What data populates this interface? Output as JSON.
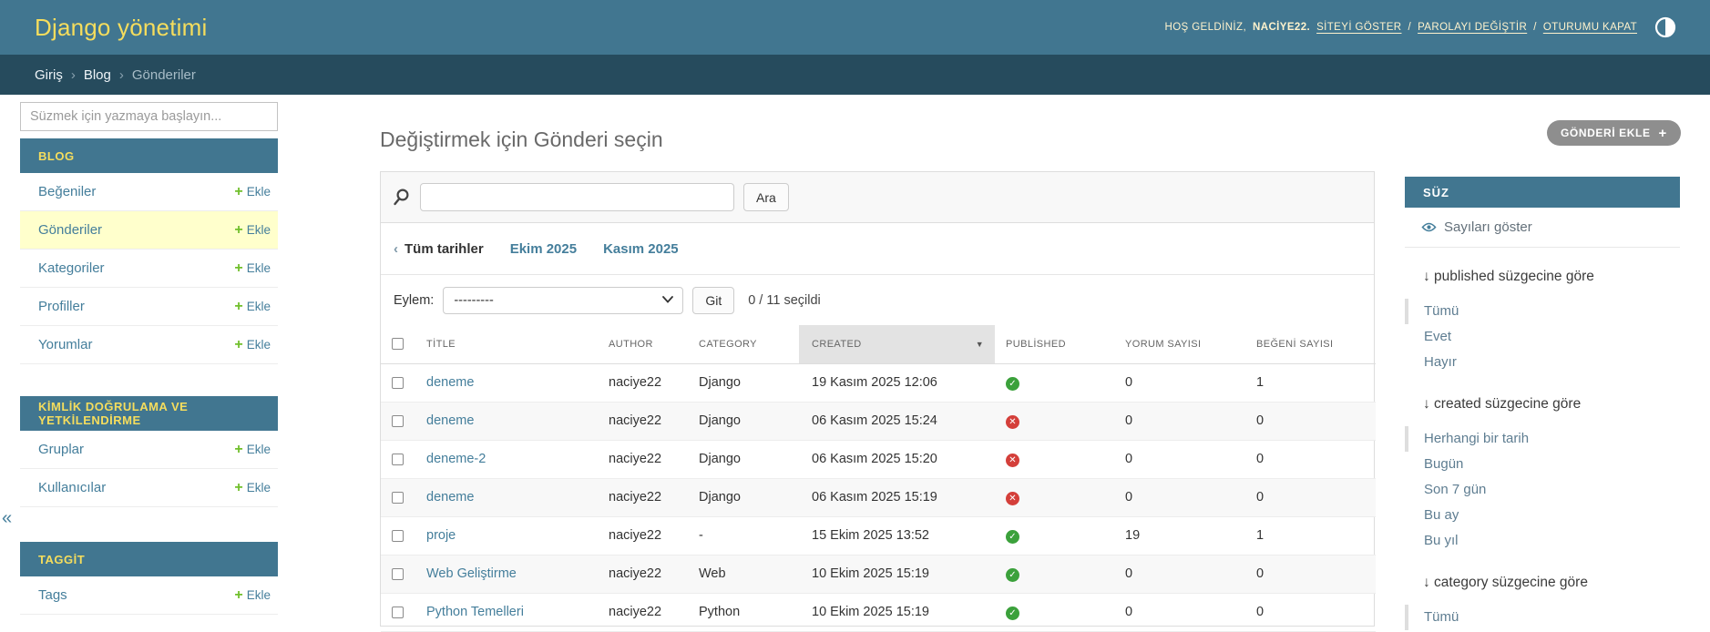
{
  "colors": {
    "header_bg": "#417690",
    "breadcrumbs_bg": "#264b5d",
    "accent": "#f5dd5d",
    "link": "#447e9b",
    "add_green": "#70bf2b",
    "selected_row_bg": "#ffffcc",
    "yes_green": "#3ba13b",
    "no_red": "#d43f3a",
    "sorted_col_bg": "#e3e3e3",
    "stripe_bg": "#f8f8f8",
    "button_gray": "#8e8e8e"
  },
  "header": {
    "title": "Django yönetimi",
    "welcome_prefix": "HOŞ GELDİNİZ,",
    "username": "NACİYE22.",
    "separator": "/",
    "links": [
      {
        "label": "SİTEYİ GÖSTER"
      },
      {
        "label": "PAROLAYI DEĞİŞTİR"
      },
      {
        "label": "OTURUMU KAPAT"
      }
    ]
  },
  "breadcrumbs": {
    "separator": "›",
    "items": [
      "Giriş",
      "Blog",
      "Gönderiler"
    ]
  },
  "sidebar": {
    "filter_placeholder": "Süzmek için yazmaya başlayın...",
    "collapse_icon": "«",
    "add_plus": "+",
    "add_label": "Ekle",
    "sections": [
      {
        "title": "BLOG",
        "items": [
          "Beğeniler",
          "Gönderiler",
          "Kategoriler",
          "Profiller",
          "Yorumlar"
        ],
        "selected": "Gönderiler"
      },
      {
        "title": "KİMLİK DOĞRULAMA VE YETKİLENDİRME",
        "items": [
          "Gruplar",
          "Kullanıcılar"
        ]
      },
      {
        "title": "TAGGİT",
        "items": [
          "Tags"
        ]
      }
    ]
  },
  "main": {
    "heading": "Değiştirmek için Gönderi seçin",
    "add_button": {
      "label": "GÖNDERİ EKLE",
      "plus": "+"
    },
    "search": {
      "value": "",
      "button": "Ara"
    },
    "date_hierarchy": {
      "back": "‹",
      "all_label": "Tüm tarihler",
      "links": [
        "Ekim 2025",
        "Kasım 2025"
      ]
    },
    "actions": {
      "label": "Eylem:",
      "selected_option": "---------",
      "go_button": "Git",
      "counter": "0 / 11 seçildi"
    },
    "table": {
      "sort_icon": "▼",
      "columns": [
        "TİTLE",
        "AUTHOR",
        "CATEGORY",
        "CREATED",
        "PUBLİSHED",
        "YORUM SAYISI",
        "BEĞENİ SAYISI"
      ],
      "sorted_column": "CREATED",
      "rows": [
        {
          "title": "deneme",
          "author": "naciye22",
          "category": "Django",
          "created": "19 Kasım 2025 12:06",
          "published": "yes",
          "comments": "0",
          "likes": "1"
        },
        {
          "title": "deneme",
          "author": "naciye22",
          "category": "Django",
          "created": "06 Kasım 2025 15:24",
          "published": "no",
          "comments": "0",
          "likes": "0"
        },
        {
          "title": "deneme-2",
          "author": "naciye22",
          "category": "Django",
          "created": "06 Kasım 2025 15:20",
          "published": "no",
          "comments": "0",
          "likes": "0"
        },
        {
          "title": "deneme",
          "author": "naciye22",
          "category": "Django",
          "created": "06 Kasım 2025 15:19",
          "published": "no",
          "comments": "0",
          "likes": "0"
        },
        {
          "title": "proje",
          "author": "naciye22",
          "category": "-",
          "created": "15 Ekim 2025 13:52",
          "published": "yes",
          "comments": "19",
          "likes": "1"
        },
        {
          "title": "Web Geliştirme",
          "author": "naciye22",
          "category": "Web",
          "created": "10 Ekim 2025 15:19",
          "published": "yes",
          "comments": "0",
          "likes": "0"
        },
        {
          "title": "Python Temelleri",
          "author": "naciye22",
          "category": "Python",
          "created": "10 Ekim 2025 15:19",
          "published": "yes",
          "comments": "0",
          "likes": "0"
        }
      ]
    }
  },
  "filters": {
    "title": "SÜZ",
    "show_counts": "Sayıları göster",
    "groups": [
      {
        "heading": "↓ published süzgecine göre",
        "options": [
          {
            "label": "Tümü",
            "selected": true
          },
          {
            "label": "Evet",
            "selected": false
          },
          {
            "label": "Hayır",
            "selected": false
          }
        ]
      },
      {
        "heading": "↓ created süzgecine göre",
        "options": [
          {
            "label": "Herhangi bir tarih",
            "selected": true
          },
          {
            "label": "Bugün",
            "selected": false
          },
          {
            "label": "Son 7 gün",
            "selected": false
          },
          {
            "label": "Bu ay",
            "selected": false
          },
          {
            "label": "Bu yıl",
            "selected": false
          }
        ]
      },
      {
        "heading": "↓ category süzgecine göre",
        "options": [
          {
            "label": "Tümü",
            "selected": true
          }
        ]
      }
    ]
  }
}
